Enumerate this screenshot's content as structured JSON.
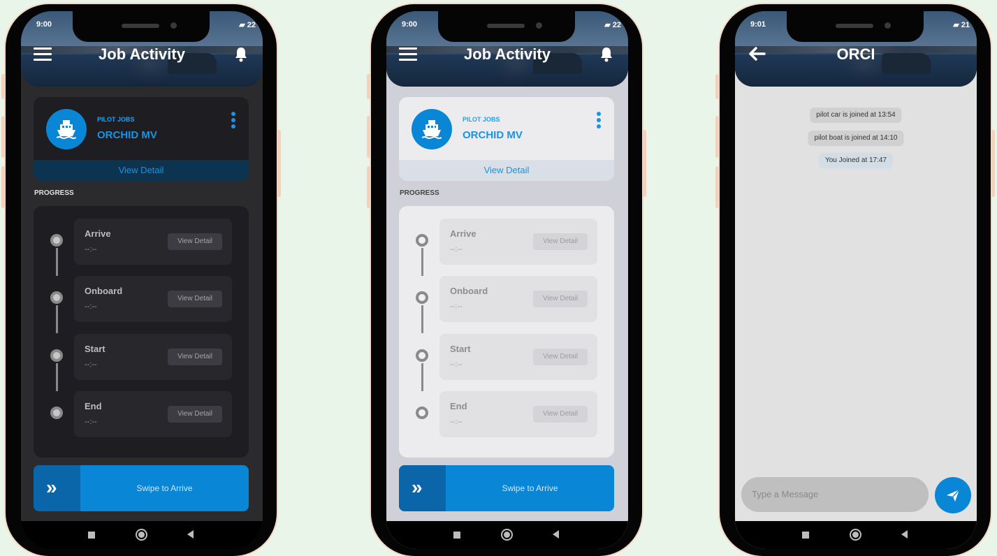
{
  "status": {
    "left_time_1": "9:00",
    "left_time_2": "9:00",
    "left_time_3": "9:01",
    "battery_1": "22",
    "battery_2": "22",
    "battery_3": "21"
  },
  "job_activity": {
    "title": "Job Activity",
    "job_label": "PILOT JOBS",
    "job_name": "ORCHID MV",
    "view_detail": "View Detail",
    "progress_label": "PROGRESS",
    "steps": [
      {
        "title": "Arrive",
        "time": "--:--",
        "button": "View Detail"
      },
      {
        "title": "Onboard",
        "time": "--:--",
        "button": "View Detail"
      },
      {
        "title": "Start",
        "time": "--:--",
        "button": "View Detail"
      },
      {
        "title": "End",
        "time": "--:--",
        "button": "View Detail"
      }
    ],
    "swipe_text": "Swipe to Arrive",
    "swipe_icon": "»"
  },
  "chat": {
    "title": "ORCI",
    "messages": [
      {
        "text": "pilot car is joined at 13:54"
      },
      {
        "text": "pilot boat is joined at 14:10"
      },
      {
        "text": "You Joined at 17:47"
      }
    ],
    "input_placeholder": "Type a Message"
  },
  "icons": {
    "menu": "menu-icon",
    "bell": "bell-icon",
    "back": "back-arrow-icon",
    "ship": "ship-icon",
    "kebab": "more-vert-icon",
    "send": "send-icon"
  },
  "colors": {
    "accent": "#0a86d6",
    "dark_bg": "#2b2b2e",
    "light_bg": "#cfd0d8"
  }
}
